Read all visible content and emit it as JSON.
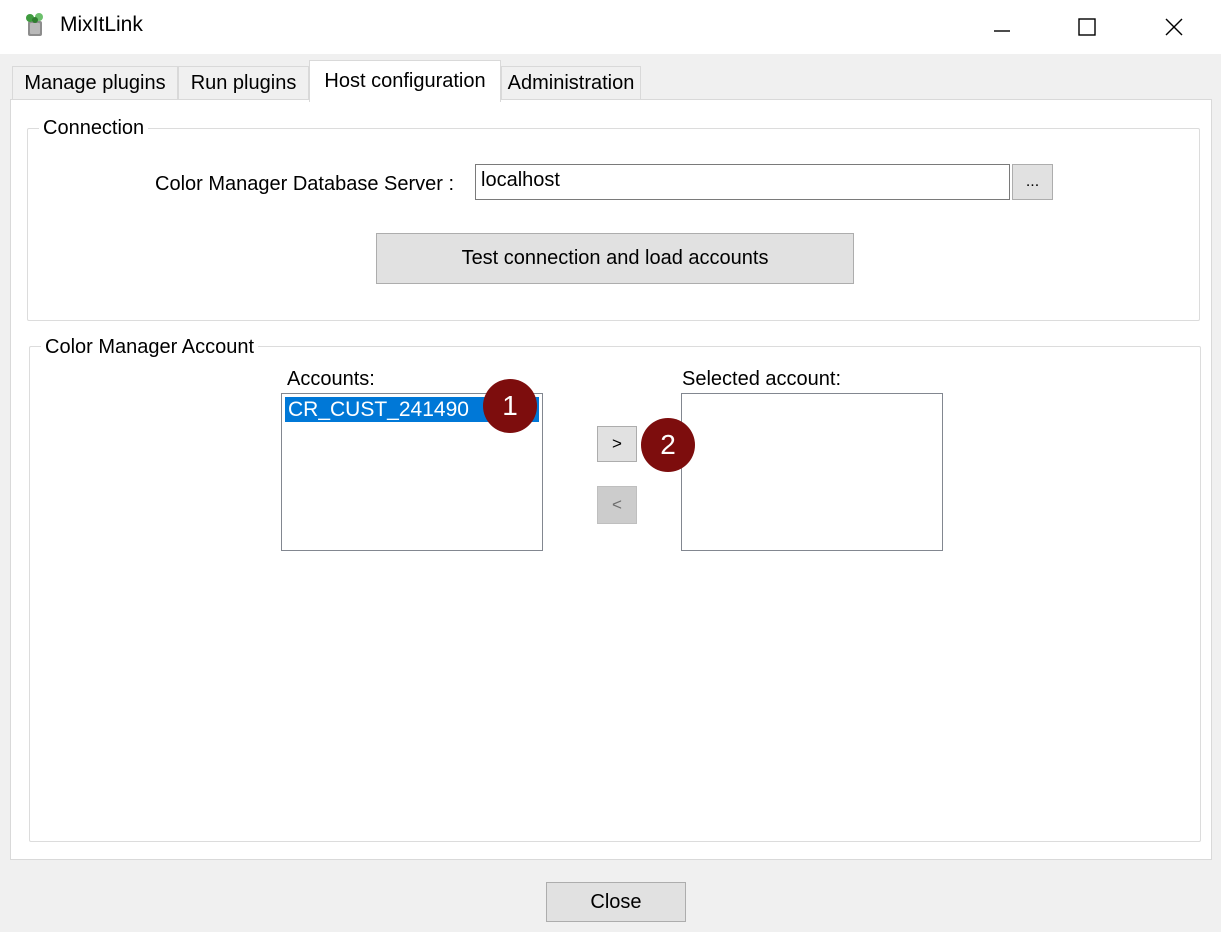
{
  "window": {
    "title": "MixItLink",
    "icon": "mixitlink-app-icon",
    "controls": {
      "minimize": "minimize-icon",
      "maximize": "maximize-icon",
      "close": "close-icon"
    }
  },
  "tabs": [
    {
      "label": "Manage plugins",
      "active": false
    },
    {
      "label": "Run plugins",
      "active": false
    },
    {
      "label": "Host configuration",
      "active": true
    },
    {
      "label": "Administration",
      "active": false
    }
  ],
  "connection": {
    "group_title": "Connection",
    "server_label": "Color Manager Database Server :",
    "server_value": "localhost",
    "browse_label": "...",
    "test_button": "Test connection and load accounts"
  },
  "account": {
    "group_title": "Color Manager Account",
    "accounts_label": "Accounts:",
    "accounts": [
      "CR_CUST_241490"
    ],
    "selected_label": "Selected account:",
    "selected_accounts": [],
    "add_button": ">",
    "remove_button": "<"
  },
  "annotations": {
    "step1": "1",
    "step2": "2",
    "color": "#7d0d0d"
  },
  "footer": {
    "close_button": "Close"
  },
  "colors": {
    "selection": "#0078d7",
    "window_bg": "#f0f0f0"
  }
}
